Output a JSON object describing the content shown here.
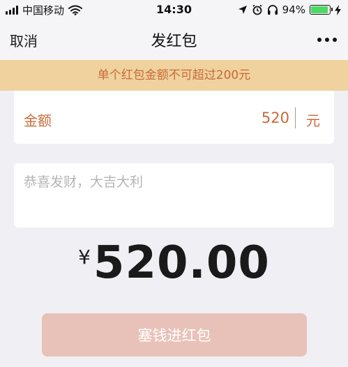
{
  "status_bar": {
    "carrier": "中国移动",
    "time": "14:30",
    "battery_percent": "94%",
    "battery_level": 0.94,
    "icons": [
      "signal-bars-icon",
      "wifi-icon",
      "location-arrow-icon",
      "alarm-icon",
      "headphones-icon",
      "battery-icon",
      "charging-bolt-icon"
    ]
  },
  "nav": {
    "cancel_label": "取消",
    "title": "发红包",
    "more_icon": "more-dots-icon"
  },
  "banner": {
    "text": "单个红包金额不可超过200元"
  },
  "amount": {
    "label": "金额",
    "value": "520",
    "unit": "元"
  },
  "greeting": {
    "placeholder": "恭喜发财，大吉大利"
  },
  "total": {
    "currency": "¥",
    "value": "520.00"
  },
  "submit": {
    "label": "塞钱进红包"
  },
  "colors": {
    "accent": "#c96a3a",
    "banner_bg": "#efd29d",
    "button_bg": "#e8c2b9",
    "page_bg": "#f0eff4",
    "battery": "#4cd964"
  }
}
